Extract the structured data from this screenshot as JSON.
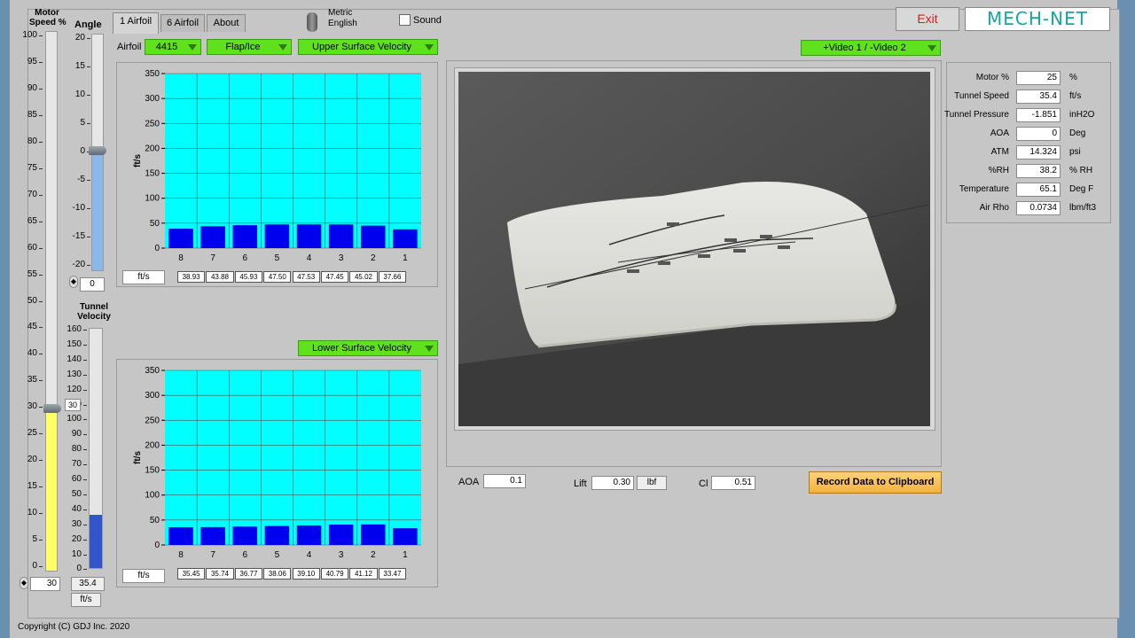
{
  "window": {
    "copyright": "Copyright (C) GDJ Inc. 2020"
  },
  "tabs": [
    {
      "label": "1 Airfoil"
    },
    {
      "label": "6 Airfoil"
    },
    {
      "label": "About"
    }
  ],
  "units_toggle": {
    "metric": "Metric",
    "english": "English"
  },
  "sound": {
    "label": "Sound",
    "checked": false
  },
  "exit": {
    "label": "Exit"
  },
  "logo": {
    "text": "MECH-NET"
  },
  "motor_slider": {
    "title_line1": "Motor",
    "title_line2": "Speed %",
    "ticks": [
      "100",
      "95",
      "90",
      "85",
      "80",
      "75",
      "70",
      "65",
      "60",
      "55",
      "50",
      "45",
      "40",
      "35",
      "30",
      "25",
      "20",
      "15",
      "10",
      "5",
      "0"
    ],
    "value": "30",
    "fill_percent": 30,
    "fill_color": "#ffff66"
  },
  "angle_slider": {
    "title": "Angle",
    "ticks": [
      "20",
      "15",
      "10",
      "5",
      "0",
      "-5",
      "-10",
      "-15",
      "-20"
    ],
    "value": "0"
  },
  "tunnel_velocity": {
    "title_line1": "Tunnel",
    "title_line2": "Velocity",
    "ticks": [
      "160",
      "150",
      "140",
      "130",
      "120",
      "110",
      "100",
      "90",
      "80",
      "70",
      "60",
      "50",
      "40",
      "30",
      "20",
      "10",
      "0"
    ],
    "value": "35.4",
    "unit": "ft/s",
    "marker": "30",
    "fill_value": 35.4,
    "fill_color": "#3355cc"
  },
  "selectors": {
    "airfoil_label": "Airfoil",
    "airfoil": "4415",
    "flap": "Flap/Ice",
    "upper": "Upper Surface Velocity",
    "lower": "Lower Surface Velocity",
    "video": "+Video 1 / -Video 2"
  },
  "upper_chart": {
    "unit_label": "ft/s",
    "chart_data": {
      "type": "bar",
      "ylabel": "ft/s",
      "ylim": [
        0,
        350
      ],
      "yticks": [
        0,
        50,
        100,
        150,
        200,
        250,
        300,
        350
      ],
      "categories": [
        "8",
        "7",
        "6",
        "5",
        "4",
        "3",
        "2",
        "1"
      ],
      "values": [
        38.93,
        43.88,
        45.93,
        47.5,
        47.53,
        47.45,
        45.02,
        37.66
      ],
      "value_labels": [
        "38.93",
        "43.88",
        "45.93",
        "47.50",
        "47.53",
        "47.45",
        "45.02",
        "37.66"
      ],
      "bar_color": "#0000ee",
      "plot_bg": "#00ffff"
    }
  },
  "lower_chart": {
    "unit_label": "ft/s",
    "chart_data": {
      "type": "bar",
      "ylabel": "ft/s",
      "ylim": [
        0,
        350
      ],
      "yticks": [
        0,
        50,
        100,
        150,
        200,
        250,
        300,
        350
      ],
      "categories": [
        "8",
        "7",
        "6",
        "5",
        "4",
        "3",
        "2",
        "1"
      ],
      "values": [
        35.45,
        35.74,
        36.77,
        38.06,
        39.1,
        40.79,
        41.12,
        33.47
      ],
      "value_labels": [
        "35.45",
        "35.74",
        "36.77",
        "38.06",
        "39.10",
        "40.79",
        "41.12",
        "33.47"
      ],
      "bar_color": "#0000ee",
      "plot_bg": "#00ffff"
    }
  },
  "readouts": [
    {
      "label": "Motor %",
      "value": "25",
      "unit": "%"
    },
    {
      "label": "Tunnel Speed",
      "value": "35.4",
      "unit": "ft/s"
    },
    {
      "label": "Tunnel Pressure",
      "value": "-1.851",
      "unit": "inH2O"
    },
    {
      "label": "AOA",
      "value": "0",
      "unit": "Deg"
    },
    {
      "label": "ATM",
      "value": "14.324",
      "unit": "psi"
    },
    {
      "label": "%RH",
      "value": "38.2",
      "unit": "% RH"
    },
    {
      "label": "Temperature",
      "value": "65.1",
      "unit": "Deg F"
    },
    {
      "label": "Air Rho",
      "value": "0.0734",
      "unit": "lbm/ft3"
    }
  ],
  "results": {
    "aoa_label": "AOA",
    "aoa_value": "0.1",
    "lift_label": "Lift",
    "lift_value": "0.30",
    "lift_unit": "lbf",
    "cl_label": "Cl",
    "cl_value": "0.51",
    "record_button": "Record Data to Clipboard"
  }
}
